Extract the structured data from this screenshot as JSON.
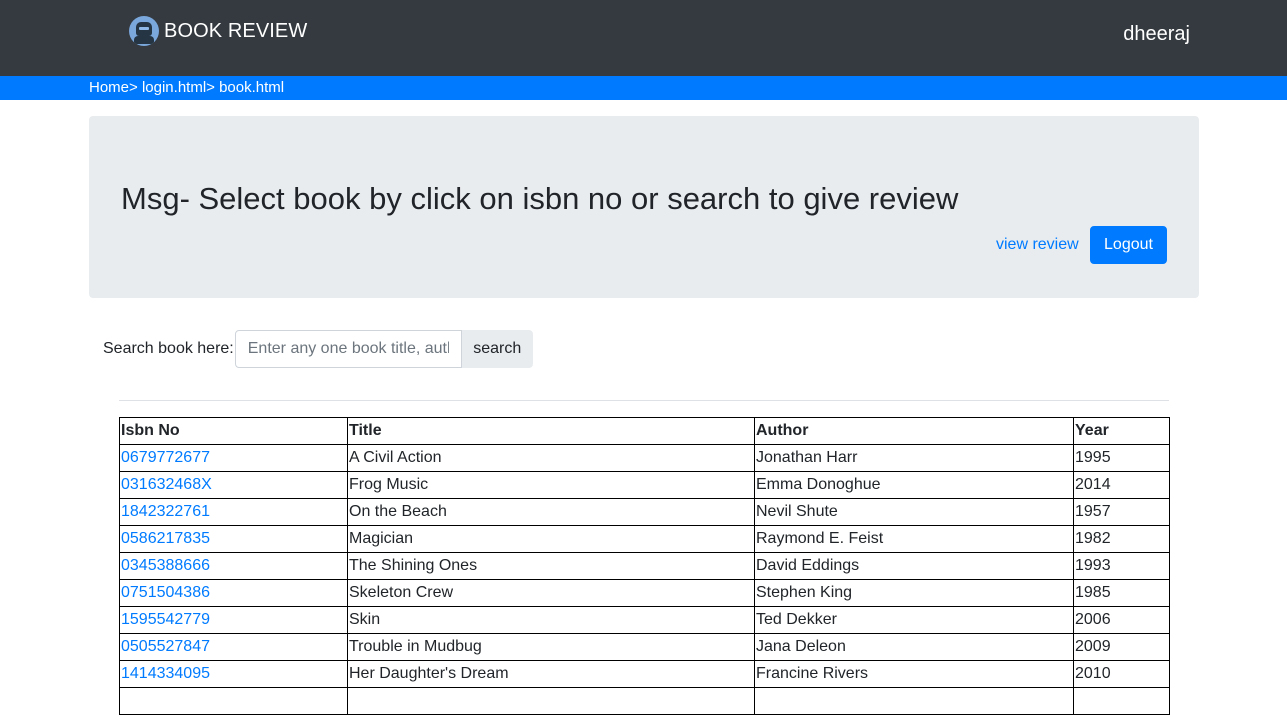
{
  "navbar": {
    "brand_title": "BOOK REVIEW",
    "brand_icon": "robot-avatar-icon",
    "username": "dheeraj"
  },
  "breadcrumb": {
    "items": [
      "Home>",
      "login.html>",
      "book.html"
    ]
  },
  "jumbotron": {
    "message": "Msg- Select book by click on isbn no or search to give review",
    "view_review_label": "view review",
    "logout_label": "Logout"
  },
  "search": {
    "label": "Search book here:",
    "placeholder": "Enter any one book title, author or isbn",
    "button_label": "search"
  },
  "table": {
    "headers": [
      "Isbn No",
      "Title",
      "Author",
      "Year"
    ],
    "rows": [
      {
        "isbn": "0679772677",
        "title": "A Civil Action",
        "author": "Jonathan Harr",
        "year": "1995"
      },
      {
        "isbn": "031632468X",
        "title": "Frog Music",
        "author": "Emma Donoghue",
        "year": "2014"
      },
      {
        "isbn": "1842322761",
        "title": "On the Beach",
        "author": "Nevil Shute",
        "year": "1957"
      },
      {
        "isbn": "0586217835",
        "title": "Magician",
        "author": "Raymond E. Feist",
        "year": "1982"
      },
      {
        "isbn": "0345388666",
        "title": "The Shining Ones",
        "author": "David Eddings",
        "year": "1993"
      },
      {
        "isbn": "0751504386",
        "title": "Skeleton Crew",
        "author": "Stephen King",
        "year": "1985"
      },
      {
        "isbn": "1595542779",
        "title": "Skin",
        "author": "Ted Dekker",
        "year": "2006"
      },
      {
        "isbn": "0505527847",
        "title": "Trouble in Mudbug",
        "author": "Jana Deleon",
        "year": "2009"
      },
      {
        "isbn": "1414334095",
        "title": "Her Daughter's Dream",
        "author": "Francine Rivers",
        "year": "2010"
      },
      {
        "isbn": "",
        "title": "",
        "author": "",
        "year": ""
      }
    ]
  },
  "colors": {
    "navbar_bg": "#343a40",
    "breadcrumb_bg": "#007bff",
    "jumbotron_bg": "#e9ecef",
    "link": "#007bff",
    "primary_button": "#007bff"
  }
}
